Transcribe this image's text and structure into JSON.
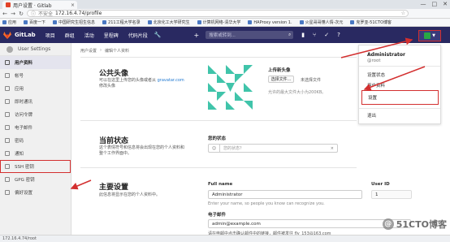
{
  "browser": {
    "tab_title": "用户设置 · Gitlab",
    "tab_close": "×",
    "window_controls": [
      "—",
      "□",
      "✕"
    ],
    "security_label": "不安全",
    "url": "172.16.4.74/profile",
    "bookmarks": [
      "应用",
      "百度一下",
      "中国研究生招生信息",
      "211工程大学名录",
      "北京化工大学研究生",
      "计算机网络-清华大学",
      "HAProxy version 1.",
      "火星哥哥懂人情-次元",
      "克罗亚-51CTO博客"
    ]
  },
  "header": {
    "brand": "GitLab",
    "nav": [
      "项目",
      "群组",
      "活动",
      "里程碑",
      "代码片段"
    ],
    "search_placeholder": "搜索或转到..."
  },
  "sidebar": {
    "title": "User Settings",
    "items": [
      {
        "label": "用户资料",
        "active": true
      },
      {
        "label": "帐号"
      },
      {
        "label": "应用"
      },
      {
        "label": "即时通讯"
      },
      {
        "label": "访问令牌"
      },
      {
        "label": "电子邮件"
      },
      {
        "label": "密码"
      },
      {
        "label": "通知"
      },
      {
        "label": "SSH 密钥",
        "highlight": true
      },
      {
        "label": "GPG 密钥"
      },
      {
        "label": "偏好设置"
      }
    ]
  },
  "main": {
    "breadcrumb": [
      "用户设置",
      "›",
      "编辑个人资料"
    ],
    "avatar_section": {
      "title": "公共头像",
      "desc_prefix": "可以在这里上传您的头像或者从 ",
      "desc_link": "gravatar.com",
      "desc_suffix": " 修改头像",
      "upload_title": "上传新头像",
      "upload_button": "选择文件...",
      "no_file": "未选择文件",
      "max_size": "允许的最大文件大小为200KB。"
    },
    "status_section": {
      "title": "当前状态",
      "desc": "这个表情符号和信息将会出现在您的个人资料和整个工作界面中。",
      "label": "您的状态",
      "placeholder": "您的状态？",
      "clear": "×"
    },
    "main_section": {
      "title": "主要设置",
      "desc": "此信息将显示在您的个人资料中。",
      "full_name_label": "Full name",
      "full_name_value": "Administrator",
      "user_id_label": "User ID",
      "user_id_value": "1",
      "full_name_help": "Enter your name, so people you know can recognize you.",
      "email_label": "电子邮件",
      "email_value": "admin@example.com",
      "email_note": "请在电邮中点击确认邮件中的链接，邮件被发往 fly_153@163.com"
    }
  },
  "dropdown": {
    "name": "Administrator",
    "handle": "@root",
    "items": [
      "设置状态",
      "用户资料",
      "设置",
      "退出"
    ]
  },
  "statusbar": {
    "url": "172.16.4.74/root"
  },
  "watermark": {
    "text": "51CTO博客",
    "badge": "@"
  },
  "colors": {
    "header_bg": "#292961",
    "annotation_red": "#d32f2f",
    "link": "#1f78d1",
    "identicon": "#40c4aa"
  }
}
